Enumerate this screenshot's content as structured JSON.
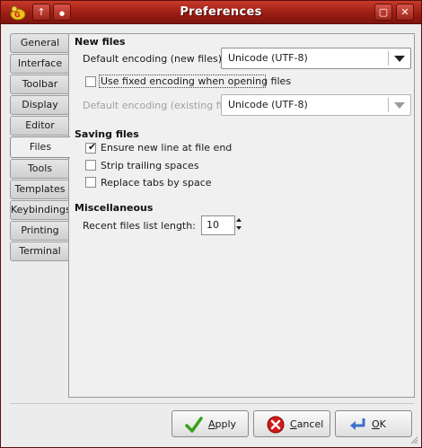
{
  "window": {
    "title": "Preferences",
    "up_glyph": "↑",
    "circle_glyph": "●",
    "maximize_glyph": "▢",
    "close_glyph": "✕"
  },
  "tabs": [
    {
      "label": "General"
    },
    {
      "label": "Interface"
    },
    {
      "label": "Toolbar"
    },
    {
      "label": "Display"
    },
    {
      "label": "Editor"
    },
    {
      "label": "Files",
      "active": true
    },
    {
      "label": "Tools"
    },
    {
      "label": "Templates"
    },
    {
      "label": "Keybindings"
    },
    {
      "label": "Printing"
    },
    {
      "label": "Terminal"
    }
  ],
  "new_files": {
    "title": "New files",
    "default_encoding_label": "Default encoding (new files):",
    "default_encoding_value": "Unicode (UTF-8)",
    "fixed_encoding_label": "Use fixed encoding when opening files",
    "fixed_encoding_checked": false,
    "existing_encoding_label": "Default encoding (existing files):",
    "existing_encoding_value": "Unicode (UTF-8)"
  },
  "saving_files": {
    "title": "Saving files",
    "options": [
      {
        "label": "Ensure new line at file end",
        "checked": true
      },
      {
        "label": "Strip trailing spaces",
        "checked": false
      },
      {
        "label": "Replace tabs by space",
        "checked": false
      }
    ]
  },
  "misc": {
    "title": "Miscellaneous",
    "recent_files_label": "Recent files list length:",
    "recent_files_value": "10"
  },
  "buttons": {
    "apply": {
      "mnemonic": "A",
      "rest": "pply"
    },
    "cancel": {
      "mnemonic": "C",
      "rest": "ancel"
    },
    "ok": {
      "mnemonic": "O",
      "rest": "K"
    }
  },
  "colors": {
    "titlebar": "#9b1d14",
    "apply_icon": "#3aa11a",
    "cancel_icon": "#d01a1a",
    "ok_icon": "#3b6fcb"
  }
}
